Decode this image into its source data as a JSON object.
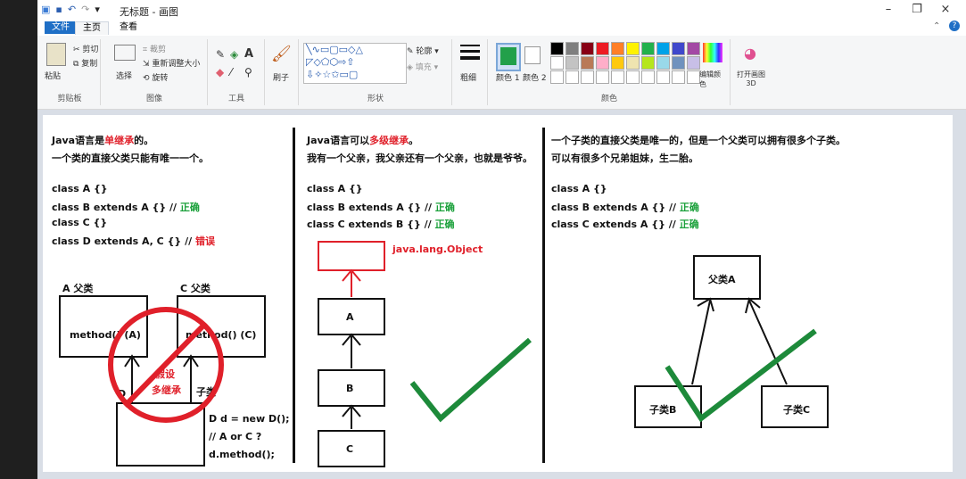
{
  "window": {
    "title": "无标题 - 画图",
    "min": "–",
    "max": "❐",
    "close": "×"
  },
  "tabs": [
    {
      "label": "文件"
    },
    {
      "label": "主页"
    },
    {
      "label": "查看"
    }
  ],
  "ribbon": {
    "clipboard": {
      "paste": "粘贴",
      "cut": "剪切",
      "copy": "复制",
      "label": "剪贴板"
    },
    "image": {
      "select": "选择",
      "crop": "裁剪",
      "resize": "重新调整大小",
      "rotate": "旋转",
      "label": "图像"
    },
    "tools": {
      "label": "工具"
    },
    "brushes": {
      "label": "刷子"
    },
    "shapes": {
      "outline": "轮廓",
      "fill": "填充",
      "label": "形状"
    },
    "size": {
      "label": "粗细"
    },
    "colors": {
      "color1": "颜色 1",
      "color2": "颜色 2",
      "edit": "编辑颜色",
      "label": "颜色",
      "palette_row1": [
        "#000000",
        "#7f7f7f",
        "#880015",
        "#ed1c24",
        "#ff7f27",
        "#fff200",
        "#22b14c",
        "#00a2e8",
        "#3f48cc",
        "#a349a4"
      ],
      "palette_row2": [
        "#ffffff",
        "#c3c3c3",
        "#b97a57",
        "#ffaec9",
        "#ffc90e",
        "#efe4b0",
        "#b5e61d",
        "#99d9ea",
        "#7092be",
        "#c8bfe7"
      ]
    },
    "paint3d": {
      "label": "打开画图 3D"
    }
  },
  "panel1": {
    "line1a": "Java语言是",
    "line1b": "单继承",
    "line1c": "的。",
    "line2": "一个类的直接父类只能有唯一一个。",
    "code1": "class A {}",
    "code2": "class B extends A {} // ",
    "code2ok": "正确",
    "code3": "class C {}",
    "code4": "class D extends A, C {} // ",
    "code4err": "错误",
    "labelA": "A  父类",
    "labelC": "C    父类",
    "methodA": "method() (A)",
    "methodC": "method() (C)",
    "labelD": "D",
    "subLabel": "子类",
    "fake1": "假设",
    "fake2": "多继承",
    "note1": "D d = new D();",
    "note2": "// A or C ?",
    "note3": "d.method();"
  },
  "panel2": {
    "line1a": "Java语言可以",
    "line1b": "多级继承",
    "line1c": "。",
    "line2": "我有一个父亲，我父亲还有一个父亲，也就是爷爷。",
    "code1": "class A {}",
    "code2": "class B extends A {} // ",
    "code2ok": "正确",
    "code3": "class C extends B {} // ",
    "code3ok": "正确",
    "object": "java.lang.Object",
    "boxA": "A",
    "boxB": "B",
    "boxC": "C"
  },
  "panel3": {
    "line1": "一个子类的直接父类是唯一的，但是一个父类可以拥有很多个子类。",
    "line2": "可以有很多个兄弟姐妹，生二胎。",
    "code1": "class A {}",
    "code2": "class B extends A {} // ",
    "code2ok": "正确",
    "code3": "class C extends A {} // ",
    "code3ok": "正确",
    "parent": "父类A",
    "childB": "子类B",
    "childC": "子类C"
  }
}
